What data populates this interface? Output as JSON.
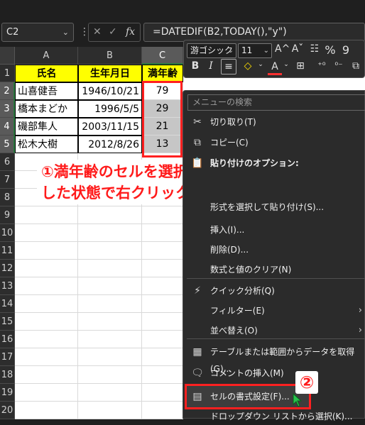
{
  "namebox": {
    "value": "C2"
  },
  "formula_bar": {
    "fx_label": "fx",
    "formula": "=DATEDIF(B2,TODAY(),\"y\")"
  },
  "columns": [
    "A",
    "B",
    "C"
  ],
  "rows": [
    "1",
    "2",
    "3",
    "4",
    "5",
    "6",
    "7",
    "8",
    "9",
    "10",
    "11",
    "12",
    "13",
    "14",
    "15",
    "16",
    "17",
    "18",
    "19",
    "20"
  ],
  "table": {
    "headers": [
      "氏名",
      "生年月日",
      "満年齢"
    ],
    "rows": [
      {
        "name": "山喜健吾",
        "birth": "1946/10/21",
        "age": "79"
      },
      {
        "name": "橋本まどか",
        "birth": "1996/5/5",
        "age": "29"
      },
      {
        "name": "磯部隼人",
        "birth": "2003/11/15",
        "age": "21"
      },
      {
        "name": "松木大樹",
        "birth": "2012/8/26",
        "age": "13"
      }
    ]
  },
  "annotation": {
    "line1": "①満年齢のセルを選択",
    "line2": "した状態で右クリック"
  },
  "mini_toolbar": {
    "font": "游ゴシック",
    "size": "11",
    "grow": "A^",
    "shrink": "Aˇ",
    "format_painter": "☷",
    "percent": "%",
    "comma": "9",
    "bold": "B",
    "italic": "I",
    "align": "≡",
    "fill": "◇",
    "fontcolor": "A",
    "borders": "⊞",
    "inc_dec": "⁺⁰",
    "dec_dec": "⁰⁻",
    "merge": "⧉"
  },
  "context_menu": {
    "search_placeholder": "メニューの検索",
    "items": [
      {
        "icon": "✂",
        "label": "切り取り(T)"
      },
      {
        "icon": "⧉",
        "label": "コピー(C)"
      },
      {
        "icon": "📋",
        "label": "貼り付けのオプション:"
      },
      {
        "icon": "",
        "label": "形式を選択して貼り付け(S)..."
      },
      {
        "icon": "",
        "label": "挿入(I)..."
      },
      {
        "icon": "",
        "label": "削除(D)..."
      },
      {
        "icon": "",
        "label": "数式と値のクリア(N)"
      },
      {
        "icon": "⚡",
        "label": "クイック分析(Q)"
      },
      {
        "icon": "",
        "label": "フィルター(E)"
      },
      {
        "icon": "",
        "label": "並べ替え(O)"
      },
      {
        "icon": "▦",
        "label": "テーブルまたは範囲からデータを取得(G)..."
      },
      {
        "icon": "🗨",
        "label": "コメントの挿入(M)"
      },
      {
        "icon": "▤",
        "label": "セルの書式設定(F)..."
      },
      {
        "icon": "",
        "label": "ドロップダウン リストから選択(K)..."
      }
    ]
  },
  "step2": "②",
  "colors": {
    "selection_red": "#ff2020",
    "header_yellow": "#ffff00",
    "excel_green": "#2a7a3f"
  }
}
